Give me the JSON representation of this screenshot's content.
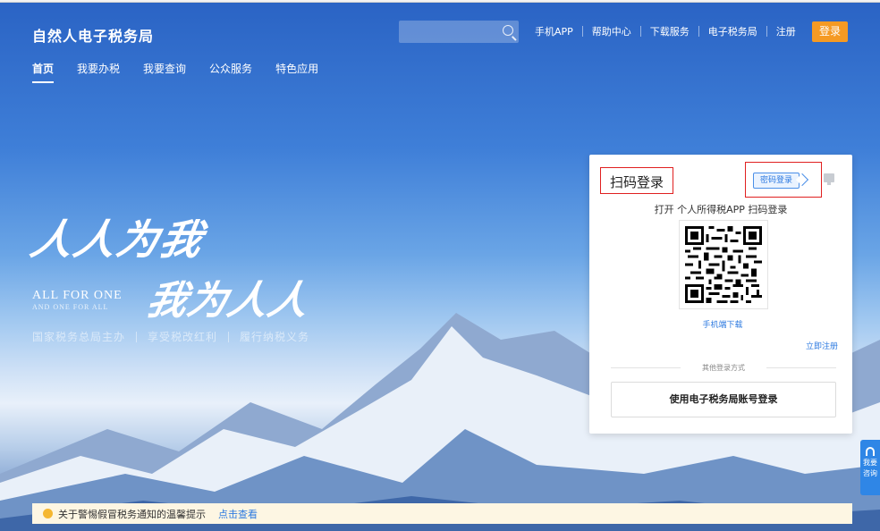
{
  "header": {
    "brand": "自然人电子税务局",
    "links": [
      "手机APP",
      "帮助中心",
      "下载服务",
      "电子税务局",
      "注册"
    ],
    "login_label": "登录",
    "search_placeholder": ""
  },
  "nav": {
    "tabs": [
      "首页",
      "我要办税",
      "我要查询",
      "公众服务",
      "特色应用"
    ],
    "active": "首页"
  },
  "hero": {
    "calligraphy_line1": "人人为我",
    "calligraphy_line2": "我为人人",
    "english_line1": "ALL FOR ONE",
    "english_line2": "AND ONE FOR ALL",
    "slogan": [
      "国家税务总局主办",
      "享受税改红利",
      "履行纳税义务"
    ]
  },
  "login_card": {
    "title": "扫码登录",
    "password_login_label": "密码登录",
    "subtitle": "打开 个人所得税APP 扫码登录",
    "download_label": "手机端下载",
    "register_label": "立即注册",
    "other_methods_label": "其他登录方式",
    "account_login_label": "使用电子税务局账号登录"
  },
  "side_widget": {
    "label": "我要咨询"
  },
  "notice": {
    "text": "关于警惕假冒税务通知的温馨提示",
    "link": "点击查看"
  },
  "colors": {
    "accent_orange": "#f59a23",
    "link_blue": "#2d7ae0",
    "highlight_red": "#e02020"
  }
}
